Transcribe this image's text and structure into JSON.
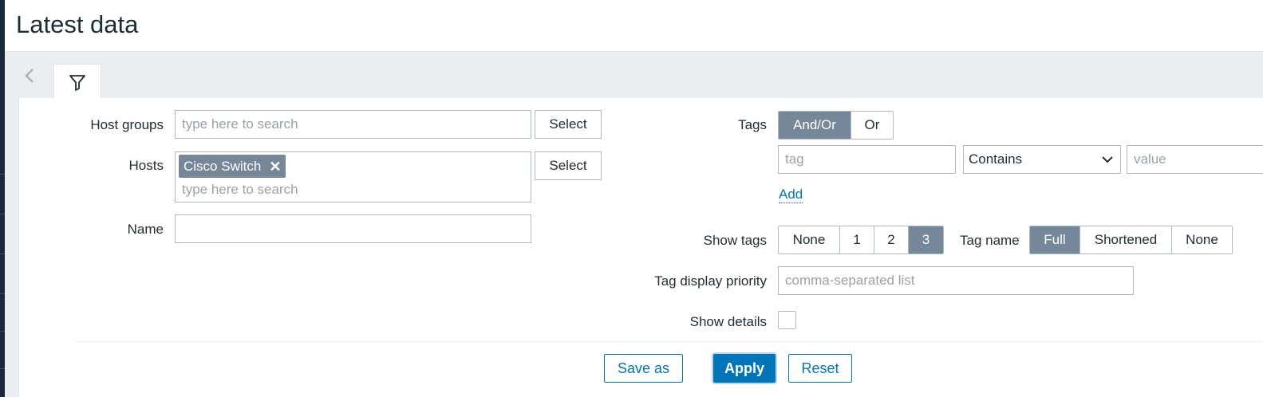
{
  "page": {
    "title": "Latest data"
  },
  "tabs": {
    "collapse_icon": "chevron-left-icon",
    "filter_icon": "funnel-icon"
  },
  "filter": {
    "host_groups": {
      "label": "Host groups",
      "placeholder": "type here to search",
      "select_label": "Select"
    },
    "hosts": {
      "label": "Hosts",
      "selected": [
        {
          "name": "Cisco Switch",
          "remove_symbol": "✕"
        }
      ],
      "placeholder": "type here to search",
      "select_label": "Select"
    },
    "name": {
      "label": "Name",
      "value": ""
    },
    "tags": {
      "label": "Tags",
      "evaltype_options": [
        "And/Or",
        "Or"
      ],
      "evaltype_selected": "And/Or",
      "rows": [
        {
          "tag_placeholder": "tag",
          "operator": "Contains",
          "value_placeholder": "value"
        }
      ],
      "add_label": "Add"
    },
    "show_tags": {
      "label": "Show tags",
      "options": [
        "None",
        "1",
        "2",
        "3"
      ],
      "selected": "3"
    },
    "tag_name": {
      "label": "Tag name",
      "options": [
        "Full",
        "Shortened",
        "None"
      ],
      "selected": "Full"
    },
    "tag_display_priority": {
      "label": "Tag display priority",
      "placeholder": "comma-separated list"
    },
    "show_details": {
      "label": "Show details",
      "checked": false
    },
    "buttons": {
      "save_as": "Save as",
      "apply": "Apply",
      "reset": "Reset"
    }
  },
  "colors": {
    "accent": "#0275b8",
    "chip": "#76879a",
    "segment_active": "#76879a",
    "border": "#acbbc2"
  }
}
